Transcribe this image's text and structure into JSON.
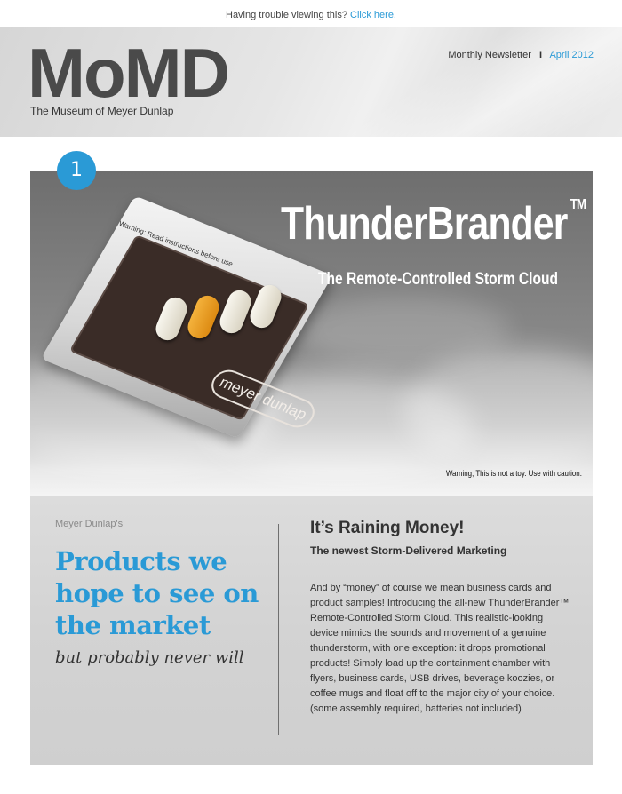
{
  "topbar": {
    "text": "Having trouble viewing this?",
    "link_label": "Click here."
  },
  "header": {
    "logo": "MoMD",
    "tagline": "The Museum of Meyer Dunlap",
    "issue_label": "Monthly Newsletter",
    "separator": "I",
    "issue_date": "April 2012"
  },
  "badge": {
    "number": "1"
  },
  "hero": {
    "title": "ThunderBrander",
    "trademark": "TM",
    "subtitle": "The Remote-Controlled Storm Cloud",
    "warning": "Warning; This is not a toy. Use with caution.",
    "device_label": "Warning: Read instructions before use",
    "device_brand": "meyer dunlap"
  },
  "content": {
    "kicker": "Meyer Dunlap's",
    "headline": "Products we hope to see on the market",
    "subheadline": "but probably never will",
    "article_title": "It’s Raining Money!",
    "article_subtitle": "The newest Storm-Delivered Marketing",
    "article_body": "And by “money” of course we mean business cards and product samples! Introducing the all-new ThunderBrander™ Remote-Controlled Storm Cloud. This realistic-looking device mimics the sounds and movement of a genuine thunderstorm, with one exception: it drops promotional products! Simply load up the containment chamber with flyers, business cards, USB drives, beverage koozies, or coffee mugs and float off to the major city of your choice. (some assembly required, batteries not included)"
  },
  "colors": {
    "accent": "#2a9ad6",
    "logo": "#4a4a4a"
  }
}
